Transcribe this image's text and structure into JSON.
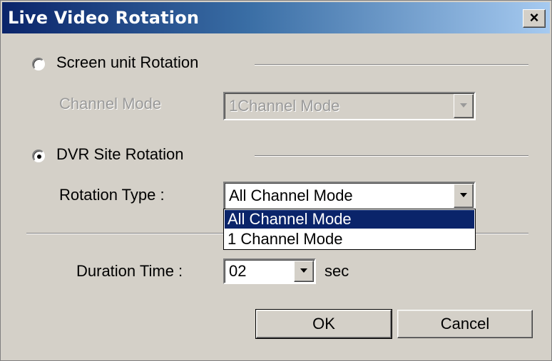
{
  "window": {
    "title": "Live Video Rotation",
    "close_label": "×"
  },
  "screen_unit": {
    "label": "Screen unit Rotation",
    "selected": false
  },
  "channel_mode": {
    "label": "Channel Mode",
    "value": "1Channel Mode",
    "enabled": false
  },
  "dvr_site": {
    "label": "DVR Site Rotation",
    "selected": true
  },
  "rotation_type": {
    "label": "Rotation Type :",
    "value": "All Channel Mode",
    "options": [
      "All Channel Mode",
      "1 Channel Mode"
    ],
    "highlighted": "All Channel Mode"
  },
  "duration": {
    "label": "Duration Time :",
    "value": "02",
    "unit": "sec"
  },
  "buttons": {
    "ok": "OK",
    "cancel": "Cancel"
  }
}
